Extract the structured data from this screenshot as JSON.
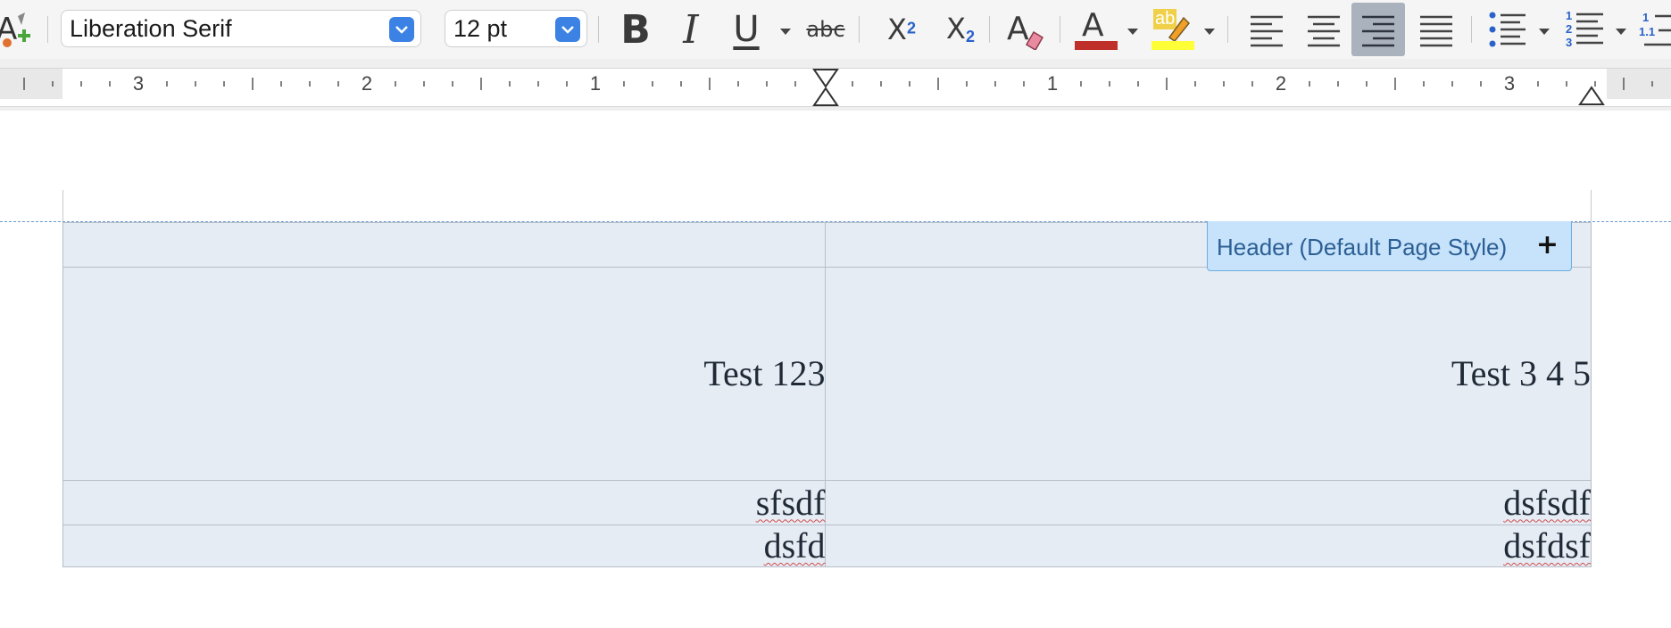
{
  "toolbar": {
    "font_name": "Liberation Serif",
    "font_size": "12 pt",
    "strikethrough_label": "abc",
    "superscript_base": "X",
    "superscript_exp": "2",
    "subscript_base": "X",
    "subscript_exp": "2",
    "font_color": "#c0302a",
    "highlight_color": "#ffff38",
    "highlight_label": "ab",
    "numbered_list_digits": [
      "1",
      "2",
      "3"
    ],
    "outline_list_digits": [
      "1",
      "1.1"
    ],
    "icons": [
      "styles-icon",
      "bold-icon",
      "italic-icon",
      "underline-icon",
      "strikethrough-icon",
      "superscript-icon",
      "subscript-icon",
      "clear-formatting-icon",
      "font-color-icon",
      "highlight-icon",
      "align-left-icon",
      "align-center-icon",
      "align-right-icon",
      "justify-icon",
      "bullet-list-icon",
      "numbered-list-icon",
      "outline-list-icon"
    ],
    "active_alignment": "right",
    "bold_label": "B",
    "italic_label": "I",
    "underline_label": "U",
    "clear_label": "A",
    "font_color_label": "A"
  },
  "ruler": {
    "left_numbers": [
      "3",
      "2",
      "1"
    ],
    "right_numbers": [
      "1",
      "2",
      "3"
    ]
  },
  "document": {
    "header_tag_label": "Header (Default Page Style)",
    "header_tag_plus": "+",
    "table": {
      "rows": [
        [
          "",
          ""
        ],
        [
          "Test 123",
          "Test 3 4 5"
        ],
        [
          "sfsdf",
          "dsfsdf"
        ],
        [
          "dsfd",
          "dsfdsf"
        ]
      ]
    }
  }
}
